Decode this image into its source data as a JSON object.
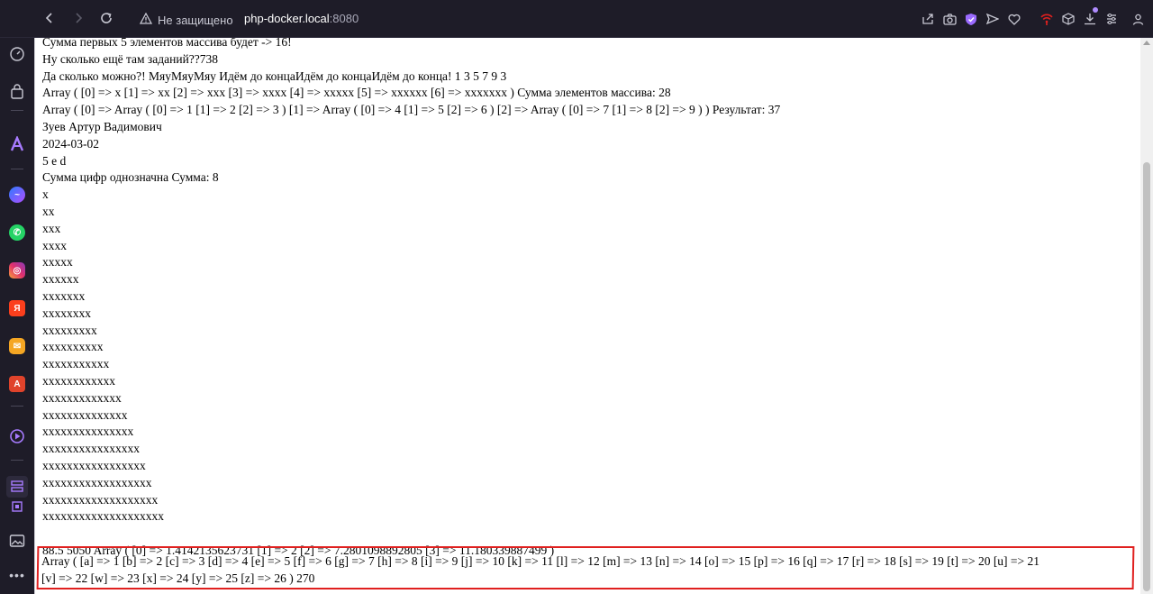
{
  "browser": {
    "security_label": "Не защищено",
    "url_host": "php-docker.local",
    "url_port": ":8080"
  },
  "icons": {
    "back": "arrow-left-icon",
    "forward": "arrow-right-icon",
    "reload": "reload-icon",
    "warning": "warning-triangle-icon"
  },
  "toolbar_icons": [
    "share-icon",
    "camera-icon",
    "shield-icon",
    "send-icon",
    "heart-icon",
    "wifi-icon",
    "cube-icon",
    "download-icon",
    "settings-icon",
    "profile-icon"
  ],
  "sidebar_icons": [
    "speed-dial-icon",
    "bag-icon",
    "aria-icon",
    "messenger-icon",
    "whatsapp-icon",
    "instagram-icon",
    "yandex-icon",
    "mail-icon",
    "translate-icon",
    "player-icon",
    "tabs-icon",
    "extensions-icon",
    "image-icon",
    "more-icon"
  ],
  "colors": {
    "highlight": "#e0201f",
    "browser_chrome": "#1e1c28"
  },
  "content": {
    "lines": [
      "Сумма первых 5 элементов массива будет -> 16!",
      "Ну сколько ещё там заданий??738",
      "Да сколько можно?! МяуМяуМяу Идём до концаИдём до концаИдём до конца! 1 3 5 7 9 3",
      "Array ( [0] => x [1] => xx [2] => xxx [3] => xxxx [4] => xxxxx [5] => xxxxxx [6] => xxxxxxx ) Сумма элементов массива: 28",
      "Array ( [0] => Array ( [0] => 1 [1] => 2 [2] => 3 ) [1] => Array ( [0] => 4 [1] => 5 [2] => 6 ) [2] => Array ( [0] => 7 [1] => 8 [2] => 9 ) ) Результат: 37",
      "Зуев Артур Вадимович",
      "2024-03-02",
      "5 e d",
      "Сумма цифр однозначна Сумма: 8",
      "x",
      "xx",
      "xxx",
      "xxxx",
      "xxxxx",
      "xxxxxx",
      "xxxxxxx",
      "xxxxxxxx",
      "xxxxxxxxx",
      "xxxxxxxxxx",
      "xxxxxxxxxxx",
      "xxxxxxxxxxxx",
      "xxxxxxxxxxxxx",
      "xxxxxxxxxxxxxx",
      "xxxxxxxxxxxxxxx",
      "xxxxxxxxxxxxxxxx",
      "xxxxxxxxxxxxxxxxx",
      "xxxxxxxxxxxxxxxxxx",
      "xxxxxxxxxxxxxxxxxxx",
      "xxxxxxxxxxxxxxxxxxxx",
      "",
      "88.5 5050 Array ( [0] => 1.4142135623731 [1] => 2 [2] => 7.2801098892805 [3] => 11.180339887499 )"
    ],
    "last_line_1": "Array ( [a] => 1 [b] => 2 [c] => 3 [d] => 4 [e] => 5 [f] => 6 [g] => 7 [h] => 8 [i] => 9 [j] => 10 [k] => 11 [l] => 12 [m] => 13 [n] => 14 [o] => 15 [p] => 16 [q] => 17 [r] => 18 [s] => 19 [t] => 20 [u] => 21",
    "last_line_2": "[v] => 22 [w] => 23 [x] => 24 [y] => 25 [z] => 26 ) 270"
  }
}
